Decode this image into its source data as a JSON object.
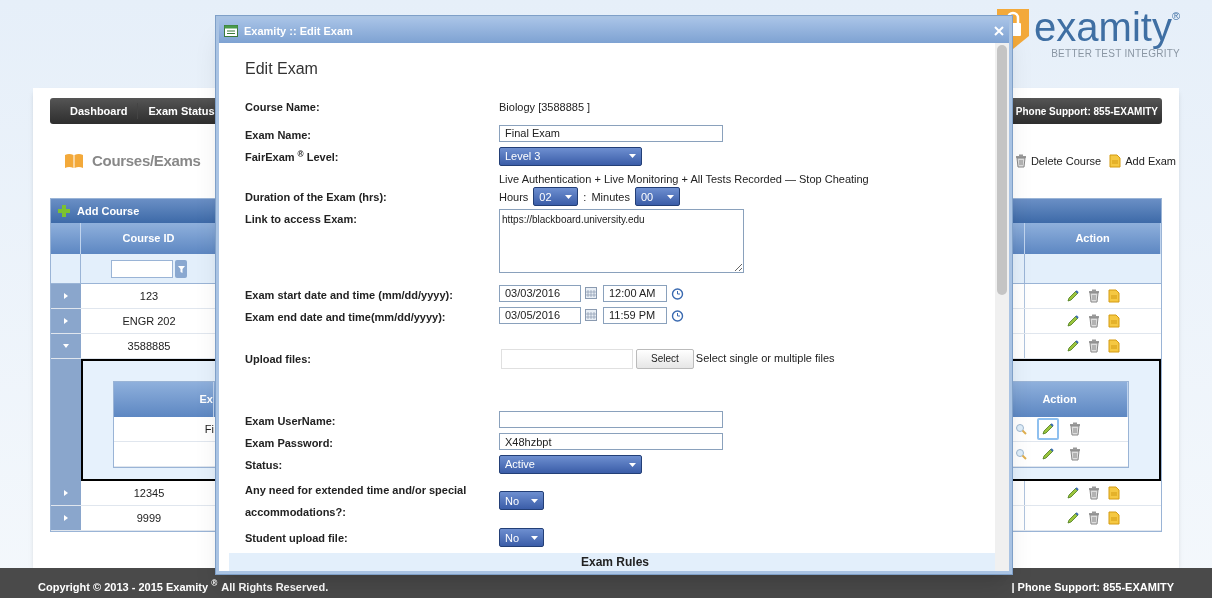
{
  "logo": {
    "name": "examity",
    "mark": "®",
    "tagline": "BETTER TEST INTEGRITY"
  },
  "nav": {
    "items": [
      {
        "label": "Dashboard"
      },
      {
        "label": "Exam Status"
      }
    ],
    "phone": "Phone Support: 855-EXAMITY"
  },
  "page_title": "Courses/Exams",
  "toolbar": [
    {
      "kind": "delete",
      "label": "Delete Course"
    },
    {
      "kind": "add",
      "label": "Add Exam"
    }
  ],
  "table": {
    "add_label": "Add Course",
    "columns": [
      "Course ID",
      "Action"
    ],
    "rows": [
      {
        "course_id": "123",
        "expanded": false
      },
      {
        "course_id": "ENGR 202",
        "expanded": false
      },
      {
        "course_id": "3588885",
        "expanded": true,
        "detail": {
          "columns": [
            "Ex",
            "Action"
          ],
          "rows": [
            {
              "cell": "Fi",
              "selected": true
            },
            {
              "selected": false
            }
          ]
        }
      },
      {
        "course_id": "12345",
        "expanded": false
      },
      {
        "course_id": "9999",
        "expanded": false
      }
    ]
  },
  "footer": {
    "copyright": "Copyright © 2013 - 2015 Examity $^{®}$",
    "rights": "All Rights Reserved.",
    "phone": "| Phone Support: 855-EXAMITY"
  },
  "modal": {
    "title": "Examity :: Edit Exam",
    "heading": "Edit Exam",
    "fields": [
      {
        "kind": "static",
        "label": "Course Name:",
        "value": "Biology [3588885 ]"
      },
      {
        "kind": "input",
        "label": "Exam Name:",
        "value": "Final Exam"
      },
      {
        "kind": "select",
        "label": "FairExam $^{®}$ Level:",
        "value": "Level 3",
        "note": "Live Authentication + Live Monitoring + All Tests Recorded — Stop Cheating"
      },
      {
        "kind": "duration",
        "label": "Duration of the Exam (hrs):",
        "hours_label": "Hours",
        "hours": "02",
        "separator": ":",
        "minutes_label": "Minutes",
        "minutes": "00"
      },
      {
        "kind": "textarea",
        "label": "Link to access Exam:",
        "value": "https://blackboard.university.edu"
      },
      {
        "kind": "datetime",
        "label": "Exam start date and time (mm/dd/yyyy):",
        "date": "03/03/2016",
        "time": "12:00 AM"
      },
      {
        "kind": "datetime",
        "label": "Exam end date and time(mm/dd/yyyy):",
        "date": "03/05/2016",
        "time": "11:59 PM"
      },
      {
        "kind": "upload",
        "label": "Upload files:",
        "button": "Select",
        "hint": "Select single or multiple files"
      },
      {
        "kind": "input",
        "label": "Exam UserName:"
      },
      {
        "kind": "input",
        "label": "Exam Password:",
        "value": "X48hzbpt"
      },
      {
        "kind": "select",
        "label": "Status:",
        "value": "Active"
      },
      {
        "kind": "small_select",
        "label": "Any need for extended time and/or special accommodations?:",
        "value": "No"
      },
      {
        "kind": "small_select",
        "label": "Student upload file:",
        "value": "No"
      }
    ],
    "section": "Exam Rules"
  }
}
